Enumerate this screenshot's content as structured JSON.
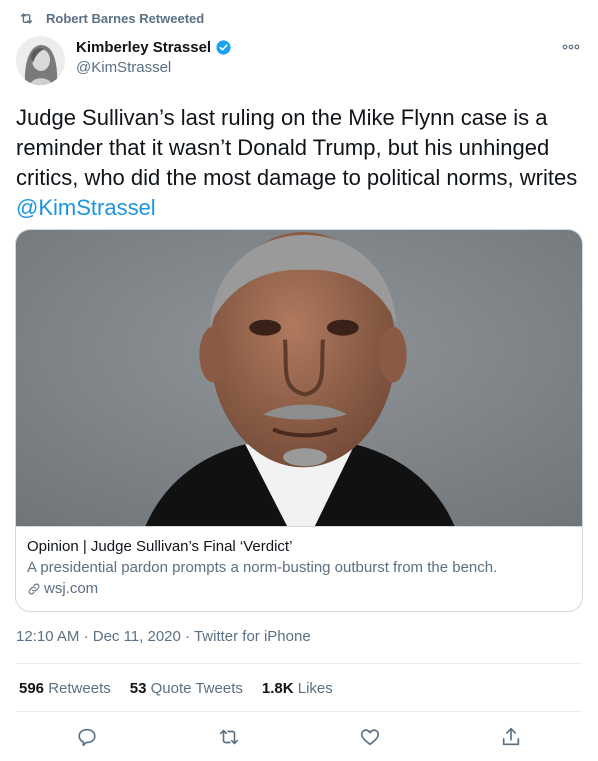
{
  "retweet_banner": {
    "icon": "retweet-icon",
    "text": "Robert Barnes Retweeted"
  },
  "author": {
    "name": "Kimberley Strassel",
    "handle": "@KimStrassel",
    "verified_icon": "verified-badge-icon",
    "accent_color": "#1da1f2"
  },
  "tweet": {
    "text_before": "Judge Sullivan’s last ruling on the Mike Flynn case is a reminder that it wasn’t Donald Trump, but his unhinged critics, who did the most damage to political norms, writes ",
    "mention": "@KimStrassel"
  },
  "card": {
    "title": "Opinion | Judge Sullivan’s Final ‘Verdict’",
    "description": "A presidential pardon prompts a norm-busting outburst from the bench.",
    "domain": "wsj.com",
    "link_icon": "link-icon"
  },
  "meta": {
    "time": "12:10 AM",
    "date": "Dec 11, 2020",
    "source": "Twitter for iPhone",
    "separator": "·"
  },
  "stats": {
    "retweets_count": "596",
    "retweets_label": "Retweets",
    "quote_count": "53",
    "quote_label": "Quote Tweets",
    "likes_count": "1.8K",
    "likes_label": "Likes"
  },
  "actions": [
    "reply-icon",
    "retweet-icon",
    "like-icon",
    "share-icon"
  ]
}
